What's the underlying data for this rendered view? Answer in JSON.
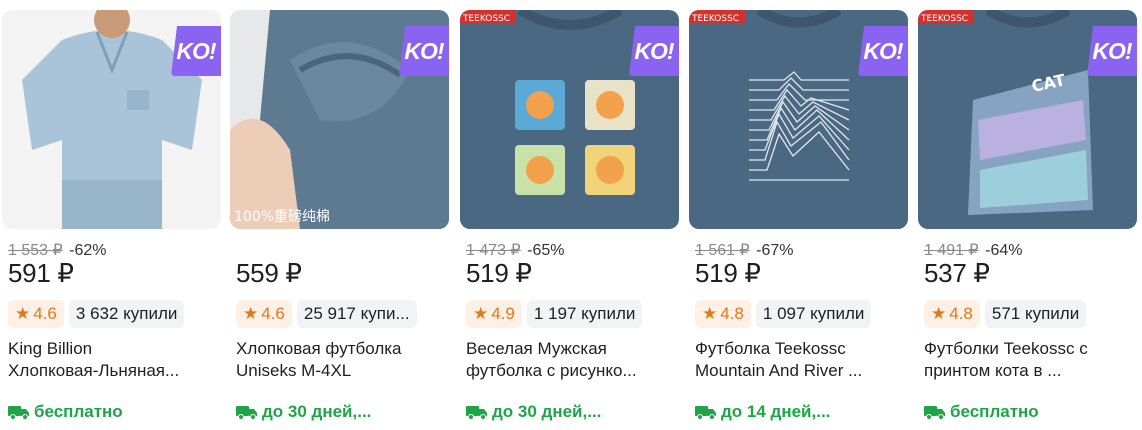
{
  "products": [
    {
      "badge": "KO!",
      "old_price": "1 553 ₽",
      "discount": "-62%",
      "price": "591 ₽",
      "rating": "4.6",
      "bought": "3 632 купили",
      "title_line1": "King Billion",
      "title_line2": "Хлопковая-Льняная...",
      "delivery": "бесплатно"
    },
    {
      "badge": "KO!",
      "image_text": "100%重磅纯棉",
      "old_price": "",
      "discount": "",
      "price": "559 ₽",
      "rating": "4.6",
      "bought": "25 917 купи...",
      "title_line1": "Хлопковая футболка",
      "title_line2": "Uniseks  M-4XL",
      "delivery": "до 30 дней,..."
    },
    {
      "badge": "KO!",
      "image_brand": "TEEKOSSC",
      "old_price": "1 473 ₽",
      "discount": "-65%",
      "price": "519 ₽",
      "rating": "4.9",
      "bought": "1 197 купили",
      "title_line1": "Веселая Мужская",
      "title_line2": "футболка с рисунко...",
      "delivery": "до 30 дней,..."
    },
    {
      "badge": "KO!",
      "image_brand": "TEEKOSSC",
      "old_price": "1 561 ₽",
      "discount": "-67%",
      "price": "519 ₽",
      "rating": "4.8",
      "bought": "1 097 купили",
      "title_line1": "Футболка Teekossc",
      "title_line2": "Mountain And River ...",
      "delivery": "до 14 дней,..."
    },
    {
      "badge": "KO!",
      "image_brand": "TEEKOSSC",
      "image_text": "CAT",
      "old_price": "1 491 ₽",
      "discount": "-64%",
      "price": "537 ₽",
      "rating": "4.8",
      "bought": "571 купили",
      "title_line1": "Футболки Teekossc с",
      "title_line2": "принтом кота в ...",
      "delivery": "бесплатно"
    }
  ],
  "icons": {
    "rating": "star-icon",
    "delivery": "delivery-truck-icon"
  },
  "colors": {
    "badge": "#8b63f2",
    "rating_text": "#e07a19",
    "rating_bg": "#fff0e5",
    "delivery": "#1ea548",
    "shirt_blue": "#4b6883"
  }
}
